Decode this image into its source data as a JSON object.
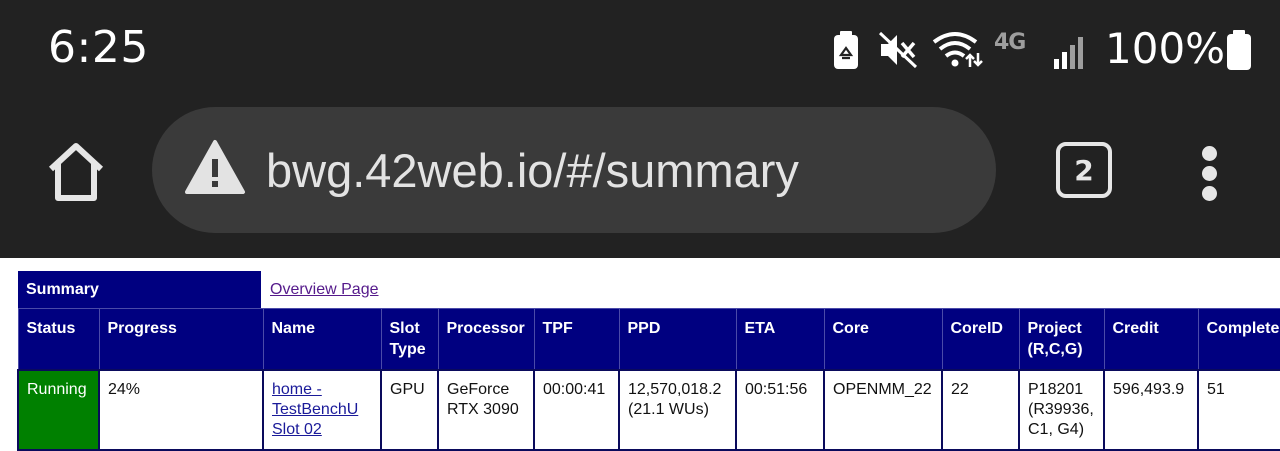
{
  "status_bar": {
    "time": "6:25",
    "network_label": "4G",
    "battery_percent": "100%",
    "icons": [
      "battery-saver-icon",
      "mute-icon",
      "wifi-icon",
      "4g-lte-icon",
      "signal-icon",
      "battery-icon"
    ]
  },
  "browser": {
    "url": "bwg.42web.io/#/summary",
    "tab_count": "2",
    "security_icon": "warning-icon",
    "colors": {
      "chrome_bg": "#222222",
      "omnibox_bg": "#3a3a3a"
    }
  },
  "page": {
    "summary_label": "Summary",
    "overview_link": "Overview Page",
    "colors": {
      "header_bg": "#000080",
      "running_bg": "#008000",
      "link": "#551a8b"
    },
    "table": {
      "columns": [
        [
          "Status"
        ],
        [
          "Progress"
        ],
        [
          "Name"
        ],
        [
          "Slot",
          "Type"
        ],
        [
          "Processor"
        ],
        [
          "TPF"
        ],
        [
          "PPD"
        ],
        [
          "ETA"
        ],
        [
          "Core"
        ],
        [
          "CoreID"
        ],
        [
          "Project",
          "(R,C,G)"
        ],
        [
          "Credit"
        ],
        [
          "Completed"
        ]
      ],
      "rows": [
        {
          "status": "Running",
          "progress": "24%",
          "name": [
            "home -",
            "TestBenchU",
            "Slot 02"
          ],
          "slot_type": "GPU",
          "processor": [
            "GeForce",
            "RTX 3090"
          ],
          "tpf": "00:00:41",
          "ppd": [
            "12,570,018.2",
            "(21.1 WUs)"
          ],
          "eta": "00:51:56",
          "core": "OPENMM_22",
          "core_id": "22",
          "project": [
            "P18201",
            "(R39936,",
            "C1, G4)"
          ],
          "credit": "596,493.9",
          "completed": "51"
        }
      ]
    }
  }
}
